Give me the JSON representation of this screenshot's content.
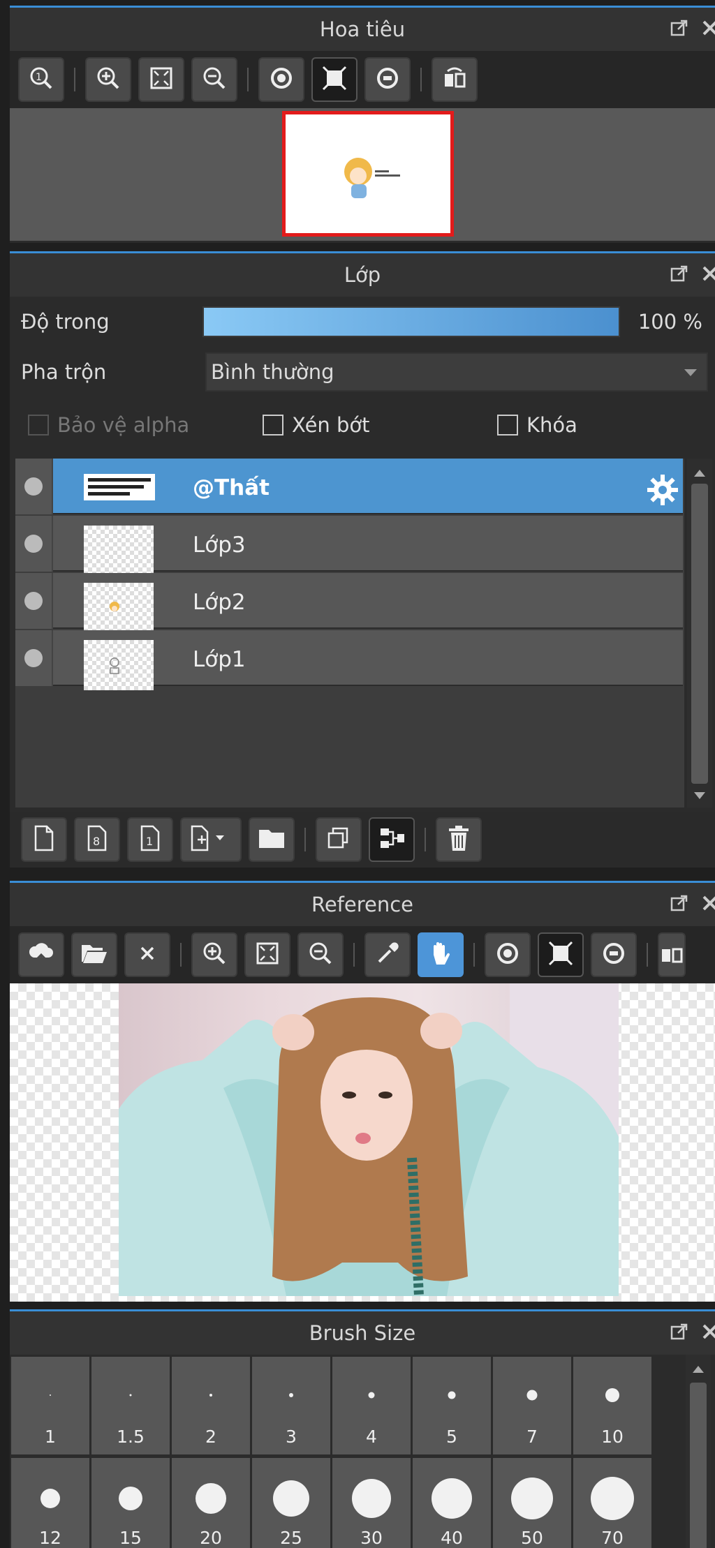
{
  "navigator": {
    "title": "Hoa tiêu"
  },
  "layers": {
    "title": "Lớp",
    "opacity_label": "Độ trong",
    "opacity_value": "100 %",
    "opacity": 1.0,
    "blend_label": "Pha trộn",
    "blend_value": "Bình thường",
    "protect_alpha": "Bảo vệ alpha",
    "clipping": "Xén bớt",
    "lock": "Khóa",
    "items": [
      {
        "name": "@Thất",
        "selected": true
      },
      {
        "name": "Lớp3",
        "selected": false
      },
      {
        "name": "Lớp2",
        "selected": false
      },
      {
        "name": "Lớp1",
        "selected": false
      }
    ]
  },
  "reference": {
    "title": "Reference"
  },
  "brush": {
    "title": "Brush Size",
    "sizes": [
      "1",
      "1.5",
      "2",
      "3",
      "4",
      "5",
      "7",
      "10",
      "12",
      "15",
      "20",
      "25",
      "30",
      "40",
      "50",
      "70"
    ]
  },
  "colors": {
    "accent": "#3a8ed6",
    "selected": "#4d95d0",
    "nav_frame": "#e21b1b"
  }
}
